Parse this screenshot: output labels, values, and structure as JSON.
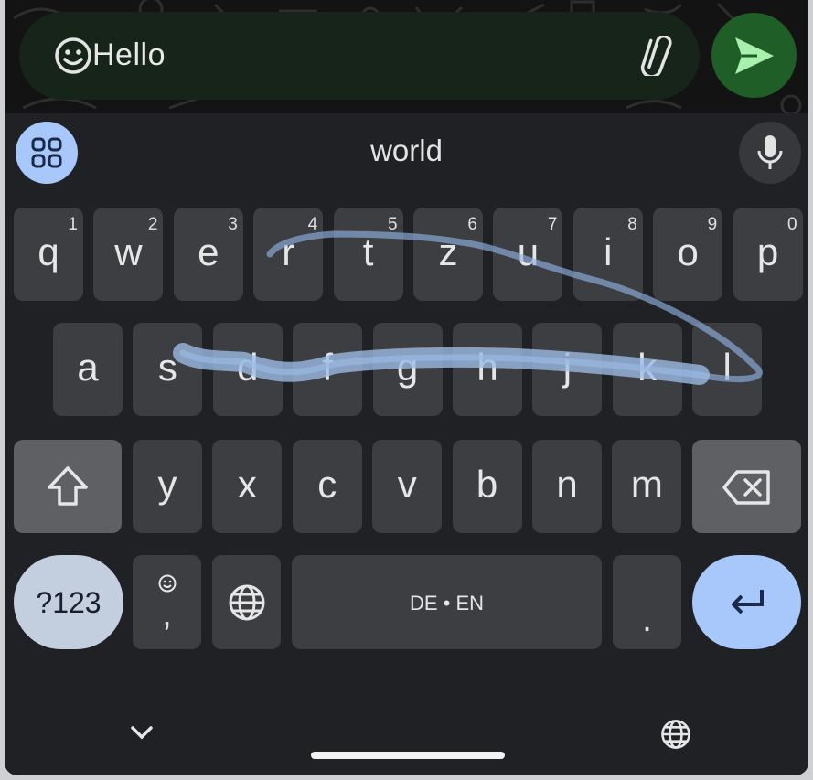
{
  "compose": {
    "text": "Hello",
    "emoji_icon": "emoji-smile-icon",
    "attach_icon": "paperclip-icon",
    "send_icon": "send-icon"
  },
  "suggestion_strip": {
    "suggestion": "world",
    "apps_icon": "apps-grid-icon",
    "mic_icon": "microphone-icon"
  },
  "keyboard": {
    "row1": [
      {
        "label": "q",
        "hint": "1"
      },
      {
        "label": "w",
        "hint": "2"
      },
      {
        "label": "e",
        "hint": "3"
      },
      {
        "label": "r",
        "hint": "4"
      },
      {
        "label": "t",
        "hint": "5"
      },
      {
        "label": "z",
        "hint": "6"
      },
      {
        "label": "u",
        "hint": "7"
      },
      {
        "label": "i",
        "hint": "8"
      },
      {
        "label": "o",
        "hint": "9"
      },
      {
        "label": "p",
        "hint": "0"
      }
    ],
    "row2": [
      "a",
      "s",
      "d",
      "f",
      "g",
      "h",
      "j",
      "k",
      "l"
    ],
    "row3": [
      "y",
      "x",
      "c",
      "v",
      "b",
      "n",
      "m"
    ],
    "symbols_label": "?123",
    "comma_label": ",",
    "period_label": ".",
    "space_label": "DE • EN",
    "shift_icon": "shift-icon",
    "backspace_icon": "backspace-icon",
    "globe_icon": "globe-icon",
    "enter_icon": "enter-icon"
  },
  "nav": {
    "collapse_icon": "chevron-down-icon",
    "language_icon": "globe-icon"
  },
  "colors": {
    "keyboard_bg": "#202125",
    "key": "#3d3e42",
    "accent": "#a8c7fa",
    "send": "#1f5f27",
    "swipe_trail": "#8fb0de"
  }
}
